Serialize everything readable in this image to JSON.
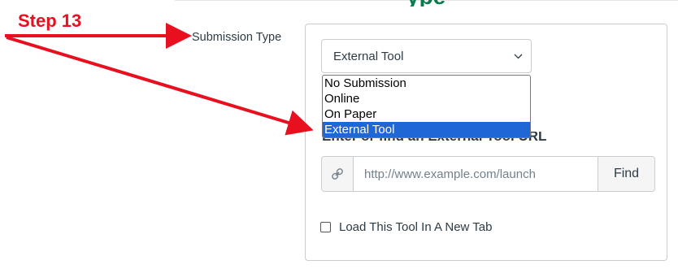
{
  "annotation": {
    "step_label": "Step 13",
    "color": "#e8101e"
  },
  "page": {
    "partial_heading": "ype"
  },
  "field": {
    "label": "Submission Type"
  },
  "select": {
    "value": "External Tool",
    "chevron": "chevron-down-icon"
  },
  "dropdown": {
    "options": [
      "No Submission",
      "Online",
      "On Paper",
      "External Tool"
    ],
    "selected_index": 3,
    "highlight_color": "#2067d6"
  },
  "external_tool": {
    "heading": "Enter or find an External Tool URL",
    "link_icon": "link-icon",
    "url_placeholder": "http://www.example.com/launch",
    "find_label": "Find"
  },
  "new_tab": {
    "label": "Load This Tool In A New Tab",
    "checked": false
  }
}
